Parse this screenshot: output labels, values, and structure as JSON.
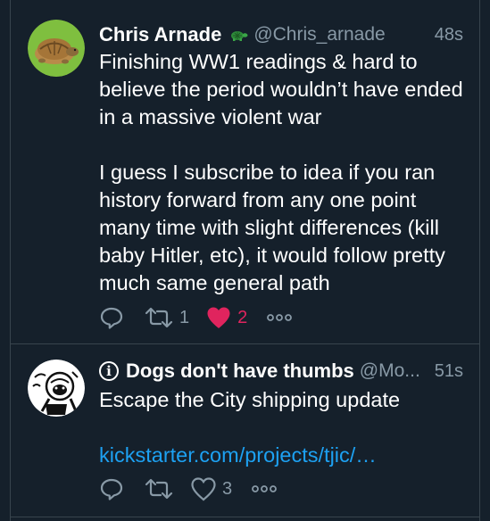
{
  "tweets": [
    {
      "name": "Chris Arnade",
      "handle": "@Chris_arnade",
      "time": "48s",
      "badge_icon": "turtle-icon",
      "avatar_icon": "turtle-avatar",
      "paragraphs": [
        "Finishing WW1 readings & hard to believe the period wouldn’t have ended in a massive violent war",
        "I guess I subscribe to idea if you ran history forward from any one point many time with slight differences (kill baby Hitler, etc), it would follow pretty much same general path"
      ],
      "actions": {
        "reply_count": "",
        "retweet_count": "1",
        "like_count": "2",
        "liked": true
      }
    },
    {
      "name": "Dogs don't have thumbs",
      "handle": "@Mo...",
      "time": "51s",
      "prefix_icon": "info-icon",
      "avatar_icon": "dog-avatar",
      "text": "Escape the City shipping update",
      "link": "kickstarter.com/projects/tjic/…",
      "actions": {
        "reply_count": "",
        "retweet_count": "",
        "like_count": "3",
        "liked": false
      }
    }
  ],
  "colors": {
    "background": "#15202b",
    "border": "#38444d",
    "secondary_text": "#8899a6",
    "link": "#1da1f2",
    "like": "#e0245e"
  }
}
